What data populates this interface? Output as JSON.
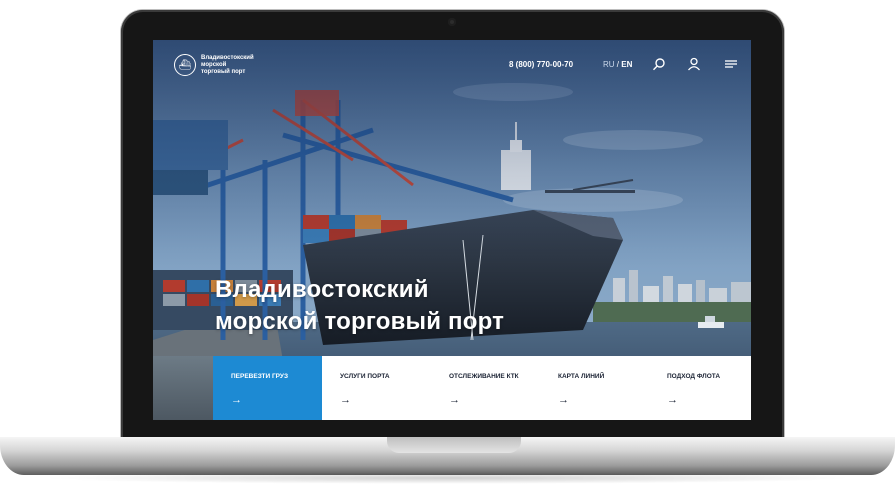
{
  "brand": {
    "name_lines": [
      "Владивостокский",
      "морской",
      "торговый порт"
    ]
  },
  "header": {
    "phone": "8 (800) 770-00-70",
    "lang_ru": "RU",
    "lang_sep": " / ",
    "lang_en": "EN",
    "icons": [
      "search-icon",
      "user-icon",
      "menu-icon"
    ]
  },
  "hero": {
    "title_lines": [
      "Владивостокский",
      "морской торговый порт"
    ]
  },
  "menu": {
    "items": [
      {
        "label": "ПЕРЕВЕЗТИ ГРУЗ",
        "arrow": "→",
        "active": true
      },
      {
        "label": "УСЛУГИ ПОРТА",
        "arrow": "→",
        "active": false
      },
      {
        "label": "ОТСЛЕЖИВАНИЕ КТК",
        "arrow": "→",
        "active": false
      },
      {
        "label": "КАРТА ЛИНИЙ",
        "arrow": "→",
        "active": false
      },
      {
        "label": "ПОДХОД ФЛОТА",
        "arrow": "→",
        "active": false
      }
    ]
  },
  "colors": {
    "accent": "#1d8ad3",
    "menu_text": "#1a2233",
    "header_text": "#ffffff"
  }
}
